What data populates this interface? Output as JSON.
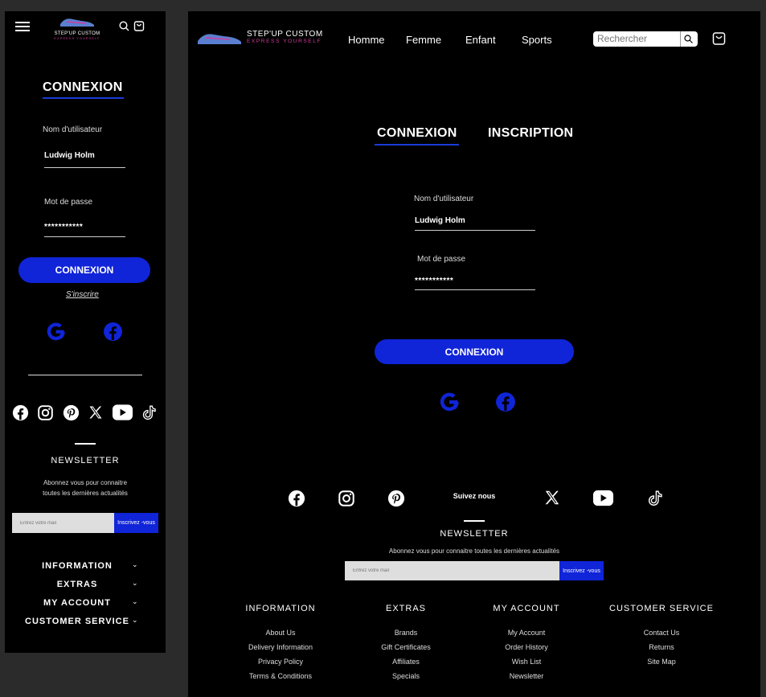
{
  "brand": {
    "name": "STEP'UP CUSTOM",
    "tagline": "EXPRESS YOURSELF"
  },
  "nav": [
    "Homme",
    "Femme",
    "Enfant",
    "Sports"
  ],
  "search": {
    "placeholder": "Rechercher"
  },
  "tabs": {
    "login": "CONNEXION",
    "register": "INSCRIPTION"
  },
  "form": {
    "username_label": "Nom d'utilisateur",
    "username_value": "Ludwig Holm",
    "password_label": "Mot de passe",
    "password_value": "***********",
    "submit_label": "CONNEXION",
    "signup_link": "S'inscrire"
  },
  "social": {
    "follow_label": "Suivez nous"
  },
  "newsletter": {
    "title": "NEWSLETTER",
    "desc_mobile_1": "Abonnez vous pour connaitre",
    "desc_mobile_2": "toutes les dernières actualités",
    "desc": "Abonnez vous pour connaitre toutes les dernières actualités",
    "email_placeholder": "Entrez votre mail",
    "subscribe": "Inscrivez -vous"
  },
  "footer": {
    "columns": [
      {
        "title": "INFORMATION",
        "links": [
          "About Us",
          "Delivery Information",
          "Privacy Policy",
          "Terms & Conditions"
        ]
      },
      {
        "title": "EXTRAS",
        "links": [
          "Brands",
          "Gift Certificates",
          "Affiliates",
          "Specials"
        ]
      },
      {
        "title": "MY ACCOUNT",
        "links": [
          "My Account",
          "Order History",
          "Wish List",
          "Newsletter"
        ]
      },
      {
        "title": "CUSTOMER SERVICE",
        "links": [
          "Contact Us",
          "Returns",
          "Site Map"
        ]
      }
    ]
  },
  "colors": {
    "accent": "#1024d8",
    "underline": "#1a3bd6",
    "brand_pink": "#d33b9c",
    "background": "#000000"
  }
}
